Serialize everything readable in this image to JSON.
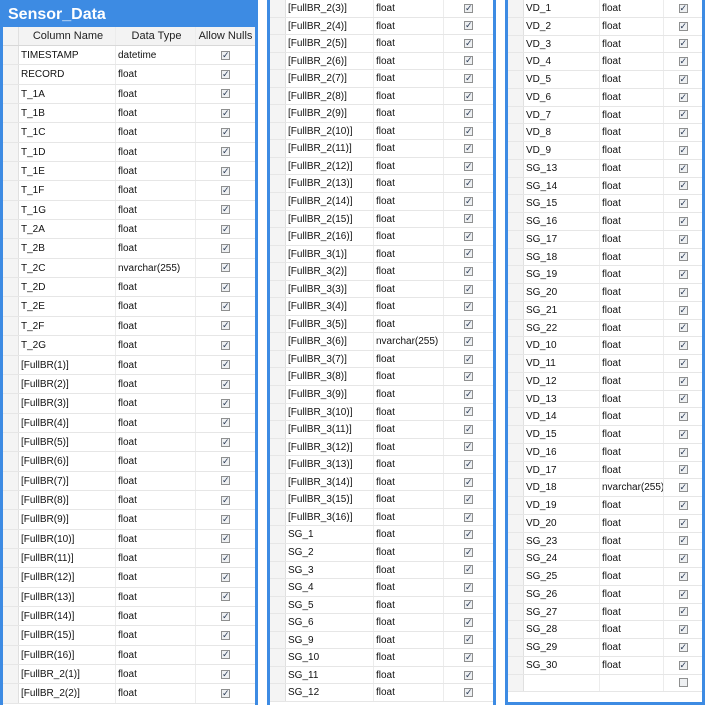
{
  "panel1": {
    "title": "Sensor_Data",
    "headers": {
      "name": "Column Name",
      "type": "Data Type",
      "nulls": "Allow Nulls"
    },
    "rows": [
      {
        "name": "TIMESTAMP",
        "type": "datetime",
        "nulls": true
      },
      {
        "name": "RECORD",
        "type": "float",
        "nulls": true
      },
      {
        "name": "T_1A",
        "type": "float",
        "nulls": true
      },
      {
        "name": "T_1B",
        "type": "float",
        "nulls": true
      },
      {
        "name": "T_1C",
        "type": "float",
        "nulls": true
      },
      {
        "name": "T_1D",
        "type": "float",
        "nulls": true
      },
      {
        "name": "T_1E",
        "type": "float",
        "nulls": true
      },
      {
        "name": "T_1F",
        "type": "float",
        "nulls": true
      },
      {
        "name": "T_1G",
        "type": "float",
        "nulls": true
      },
      {
        "name": "T_2A",
        "type": "float",
        "nulls": true
      },
      {
        "name": "T_2B",
        "type": "float",
        "nulls": true
      },
      {
        "name": "T_2C",
        "type": "nvarchar(255)",
        "nulls": true
      },
      {
        "name": "T_2D",
        "type": "float",
        "nulls": true
      },
      {
        "name": "T_2E",
        "type": "float",
        "nulls": true
      },
      {
        "name": "T_2F",
        "type": "float",
        "nulls": true
      },
      {
        "name": "T_2G",
        "type": "float",
        "nulls": true
      },
      {
        "name": "[FullBR(1)]",
        "type": "float",
        "nulls": true
      },
      {
        "name": "[FullBR(2)]",
        "type": "float",
        "nulls": true
      },
      {
        "name": "[FullBR(3)]",
        "type": "float",
        "nulls": true
      },
      {
        "name": "[FullBR(4)]",
        "type": "float",
        "nulls": true
      },
      {
        "name": "[FullBR(5)]",
        "type": "float",
        "nulls": true
      },
      {
        "name": "[FullBR(6)]",
        "type": "float",
        "nulls": true
      },
      {
        "name": "[FullBR(7)]",
        "type": "float",
        "nulls": true
      },
      {
        "name": "[FullBR(8)]",
        "type": "float",
        "nulls": true
      },
      {
        "name": "[FullBR(9)]",
        "type": "float",
        "nulls": true
      },
      {
        "name": "[FullBR(10)]",
        "type": "float",
        "nulls": true
      },
      {
        "name": "[FullBR(11)]",
        "type": "float",
        "nulls": true
      },
      {
        "name": "[FullBR(12)]",
        "type": "float",
        "nulls": true
      },
      {
        "name": "[FullBR(13)]",
        "type": "float",
        "nulls": true
      },
      {
        "name": "[FullBR(14)]",
        "type": "float",
        "nulls": true
      },
      {
        "name": "[FullBR(15)]",
        "type": "float",
        "nulls": true
      },
      {
        "name": "[FullBR(16)]",
        "type": "float",
        "nulls": true
      },
      {
        "name": "[FullBR_2(1)]",
        "type": "float",
        "nulls": true
      },
      {
        "name": "[FullBR_2(2)]",
        "type": "float",
        "nulls": true
      }
    ]
  },
  "panel2": {
    "rows": [
      {
        "name": "[FullBR_2(3)]",
        "type": "float",
        "nulls": true
      },
      {
        "name": "[FullBR_2(4)]",
        "type": "float",
        "nulls": true
      },
      {
        "name": "[FullBR_2(5)]",
        "type": "float",
        "nulls": true
      },
      {
        "name": "[FullBR_2(6)]",
        "type": "float",
        "nulls": true
      },
      {
        "name": "[FullBR_2(7)]",
        "type": "float",
        "nulls": true
      },
      {
        "name": "[FullBR_2(8)]",
        "type": "float",
        "nulls": true
      },
      {
        "name": "[FullBR_2(9)]",
        "type": "float",
        "nulls": true
      },
      {
        "name": "[FullBR_2(10)]",
        "type": "float",
        "nulls": true
      },
      {
        "name": "[FullBR_2(11)]",
        "type": "float",
        "nulls": true
      },
      {
        "name": "[FullBR_2(12)]",
        "type": "float",
        "nulls": true
      },
      {
        "name": "[FullBR_2(13)]",
        "type": "float",
        "nulls": true
      },
      {
        "name": "[FullBR_2(14)]",
        "type": "float",
        "nulls": true
      },
      {
        "name": "[FullBR_2(15)]",
        "type": "float",
        "nulls": true
      },
      {
        "name": "[FullBR_2(16)]",
        "type": "float",
        "nulls": true
      },
      {
        "name": "[FullBR_3(1)]",
        "type": "float",
        "nulls": true
      },
      {
        "name": "[FullBR_3(2)]",
        "type": "float",
        "nulls": true
      },
      {
        "name": "[FullBR_3(3)]",
        "type": "float",
        "nulls": true
      },
      {
        "name": "[FullBR_3(4)]",
        "type": "float",
        "nulls": true
      },
      {
        "name": "[FullBR_3(5)]",
        "type": "float",
        "nulls": true
      },
      {
        "name": "[FullBR_3(6)]",
        "type": "nvarchar(255)",
        "nulls": true
      },
      {
        "name": "[FullBR_3(7)]",
        "type": "float",
        "nulls": true
      },
      {
        "name": "[FullBR_3(8)]",
        "type": "float",
        "nulls": true
      },
      {
        "name": "[FullBR_3(9)]",
        "type": "float",
        "nulls": true
      },
      {
        "name": "[FullBR_3(10)]",
        "type": "float",
        "nulls": true
      },
      {
        "name": "[FullBR_3(11)]",
        "type": "float",
        "nulls": true
      },
      {
        "name": "[FullBR_3(12)]",
        "type": "float",
        "nulls": true
      },
      {
        "name": "[FullBR_3(13)]",
        "type": "float",
        "nulls": true
      },
      {
        "name": "[FullBR_3(14)]",
        "type": "float",
        "nulls": true
      },
      {
        "name": "[FullBR_3(15)]",
        "type": "float",
        "nulls": true
      },
      {
        "name": "[FullBR_3(16)]",
        "type": "float",
        "nulls": true
      },
      {
        "name": "SG_1",
        "type": "float",
        "nulls": true
      },
      {
        "name": "SG_2",
        "type": "float",
        "nulls": true
      },
      {
        "name": "SG_3",
        "type": "float",
        "nulls": true
      },
      {
        "name": "SG_4",
        "type": "float",
        "nulls": true
      },
      {
        "name": "SG_5",
        "type": "float",
        "nulls": true
      },
      {
        "name": "SG_6",
        "type": "float",
        "nulls": true
      },
      {
        "name": "SG_9",
        "type": "float",
        "nulls": true
      },
      {
        "name": "SG_10",
        "type": "float",
        "nulls": true
      },
      {
        "name": "SG_11",
        "type": "float",
        "nulls": true
      },
      {
        "name": "SG_12",
        "type": "float",
        "nulls": true
      }
    ]
  },
  "panel3": {
    "rows": [
      {
        "name": "VD_1",
        "type": "float",
        "nulls": true
      },
      {
        "name": "VD_2",
        "type": "float",
        "nulls": true
      },
      {
        "name": "VD_3",
        "type": "float",
        "nulls": true
      },
      {
        "name": "VD_4",
        "type": "float",
        "nulls": true
      },
      {
        "name": "VD_5",
        "type": "float",
        "nulls": true
      },
      {
        "name": "VD_6",
        "type": "float",
        "nulls": true
      },
      {
        "name": "VD_7",
        "type": "float",
        "nulls": true
      },
      {
        "name": "VD_8",
        "type": "float",
        "nulls": true
      },
      {
        "name": "VD_9",
        "type": "float",
        "nulls": true
      },
      {
        "name": "SG_13",
        "type": "float",
        "nulls": true
      },
      {
        "name": "SG_14",
        "type": "float",
        "nulls": true
      },
      {
        "name": "SG_15",
        "type": "float",
        "nulls": true
      },
      {
        "name": "SG_16",
        "type": "float",
        "nulls": true
      },
      {
        "name": "SG_17",
        "type": "float",
        "nulls": true
      },
      {
        "name": "SG_18",
        "type": "float",
        "nulls": true
      },
      {
        "name": "SG_19",
        "type": "float",
        "nulls": true
      },
      {
        "name": "SG_20",
        "type": "float",
        "nulls": true
      },
      {
        "name": "SG_21",
        "type": "float",
        "nulls": true
      },
      {
        "name": "SG_22",
        "type": "float",
        "nulls": true
      },
      {
        "name": "VD_10",
        "type": "float",
        "nulls": true
      },
      {
        "name": "VD_11",
        "type": "float",
        "nulls": true
      },
      {
        "name": "VD_12",
        "type": "float",
        "nulls": true
      },
      {
        "name": "VD_13",
        "type": "float",
        "nulls": true
      },
      {
        "name": "VD_14",
        "type": "float",
        "nulls": true
      },
      {
        "name": "VD_15",
        "type": "float",
        "nulls": true
      },
      {
        "name": "VD_16",
        "type": "float",
        "nulls": true
      },
      {
        "name": "VD_17",
        "type": "float",
        "nulls": true
      },
      {
        "name": "VD_18",
        "type": "nvarchar(255)",
        "nulls": true
      },
      {
        "name": "VD_19",
        "type": "float",
        "nulls": true
      },
      {
        "name": "VD_20",
        "type": "float",
        "nulls": true
      },
      {
        "name": "SG_23",
        "type": "float",
        "nulls": true
      },
      {
        "name": "SG_24",
        "type": "float",
        "nulls": true
      },
      {
        "name": "SG_25",
        "type": "float",
        "nulls": true
      },
      {
        "name": "SG_26",
        "type": "float",
        "nulls": true
      },
      {
        "name": "SG_27",
        "type": "float",
        "nulls": true
      },
      {
        "name": "SG_28",
        "type": "float",
        "nulls": true
      },
      {
        "name": "SG_29",
        "type": "float",
        "nulls": true
      },
      {
        "name": "SG_30",
        "type": "float",
        "nulls": true
      },
      {
        "name": "",
        "type": "",
        "nulls": false
      }
    ]
  },
  "colors": {
    "accent": "#3d8be3"
  }
}
